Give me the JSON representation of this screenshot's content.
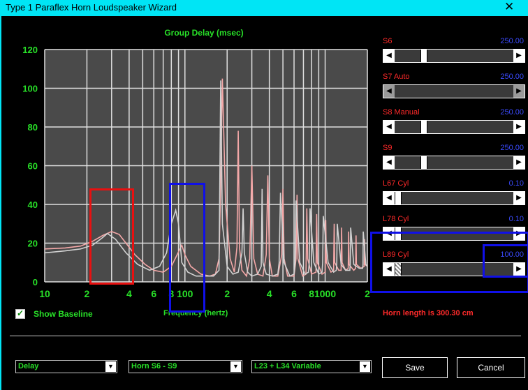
{
  "window": {
    "title": "Type 1 Paraflex Horn Loudspeaker Wizard",
    "close_glyph": "✕"
  },
  "chart_data": {
    "type": "line",
    "title": "Group Delay (msec)",
    "xlabel": "Frequency (hertz)",
    "ylabel": "",
    "x_scale": "log",
    "xlim": [
      10,
      2000
    ],
    "ylim": [
      0,
      120
    ],
    "x_ticks": [
      {
        "v": 10,
        "label": "10"
      },
      {
        "v": 20,
        "label": "2"
      },
      {
        "v": 40,
        "label": "4"
      },
      {
        "v": 60,
        "label": "6"
      },
      {
        "v": 80,
        "label": "8"
      },
      {
        "v": 100,
        "label": "100"
      },
      {
        "v": 200,
        "label": "2"
      },
      {
        "v": 400,
        "label": "4"
      },
      {
        "v": 600,
        "label": "6"
      },
      {
        "v": 800,
        "label": "8"
      },
      {
        "v": 1000,
        "label": "1000"
      },
      {
        "v": 2000,
        "label": "2"
      }
    ],
    "y_ticks": [
      0,
      20,
      40,
      60,
      80,
      100,
      120
    ],
    "grid": true,
    "legend": "none",
    "series": [
      {
        "color": "#f4a8a8",
        "x": [
          10,
          14,
          18,
          22,
          26,
          30,
          34,
          38,
          44,
          52,
          60,
          70,
          80,
          88,
          95,
          100,
          110,
          130,
          150,
          165,
          175,
          180,
          185,
          195,
          210,
          225,
          235,
          240,
          245,
          255,
          275,
          290,
          300,
          310,
          330,
          360,
          380,
          390,
          400,
          420,
          460,
          490,
          500,
          510,
          540,
          600,
          620,
          630,
          640,
          690,
          730,
          740,
          750,
          800,
          860,
          870,
          880,
          950,
          1000,
          1010,
          1020,
          1100,
          1150,
          1160,
          1170,
          1250,
          1300,
          1310,
          1320,
          1400,
          1460,
          1470,
          1480,
          1600,
          1650,
          1660,
          1670,
          1800,
          1900,
          1910,
          1920,
          2000
        ],
        "y": [
          17,
          17.5,
          18.5,
          21,
          24,
          26,
          24.5,
          20,
          14,
          9,
          6,
          5,
          8,
          14,
          19,
          14,
          8,
          4,
          3,
          4,
          12,
          50,
          105,
          40,
          12,
          5,
          18,
          78,
          18,
          6,
          3,
          12,
          60,
          12,
          4,
          3,
          14,
          55,
          12,
          3,
          3,
          14,
          48,
          12,
          3,
          3,
          12,
          45,
          12,
          3,
          4,
          38,
          12,
          4,
          5,
          35,
          10,
          4,
          5,
          32,
          10,
          5,
          6,
          30,
          10,
          6,
          6,
          28,
          10,
          6,
          7,
          26,
          9,
          6,
          7,
          24,
          9,
          7,
          8,
          22,
          9,
          8
        ]
      },
      {
        "color": "#d2d2d2",
        "x": [
          10,
          14,
          18,
          22,
          26,
          28,
          32,
          38,
          46,
          56,
          66,
          74,
          80,
          86,
          90,
          95,
          105,
          120,
          140,
          160,
          175,
          180,
          185,
          200,
          220,
          240,
          255,
          260,
          265,
          280,
          300,
          330,
          350,
          355,
          360,
          380,
          420,
          460,
          470,
          480,
          510,
          560,
          600,
          610,
          620,
          660,
          720,
          760,
          770,
          780,
          830,
          900,
          950,
          960,
          970,
          1050,
          1150,
          1200,
          1210,
          1220,
          1300,
          1400,
          1500,
          1510,
          1520,
          1600,
          1750,
          1850,
          1860,
          1870,
          1950,
          2000
        ],
        "y": [
          15,
          16,
          17,
          19,
          23,
          25,
          22,
          15,
          9,
          6,
          8,
          15,
          30,
          37,
          30,
          10,
          5,
          3,
          3,
          3,
          6,
          104,
          30,
          8,
          4,
          5,
          15,
          38,
          15,
          5,
          3,
          4,
          8,
          48,
          10,
          4,
          3,
          4,
          10,
          46,
          10,
          3,
          4,
          10,
          42,
          10,
          4,
          5,
          10,
          38,
          10,
          4,
          5,
          10,
          34,
          10,
          5,
          6,
          10,
          30,
          9,
          6,
          6,
          9,
          28,
          9,
          7,
          7,
          9,
          26,
          9,
          8
        ]
      }
    ]
  },
  "sliders": [
    {
      "label": "S6",
      "value": "250.00",
      "thumb": 0.23,
      "grey": false
    },
    {
      "label": "S7  Auto",
      "value": "250.00",
      "thumb": 0.23,
      "grey": true
    },
    {
      "label": "S8  Manual",
      "value": "250.00",
      "thumb": 0.23,
      "grey": false
    },
    {
      "label": "S9",
      "value": "250.00",
      "thumb": 0.23,
      "grey": false
    },
    {
      "label": "L67  Cyl",
      "value": "0.10",
      "thumb": 0.0,
      "grey": false
    },
    {
      "label": "L78  Cyl",
      "value": "0.10",
      "thumb": 0.0,
      "grey": false
    },
    {
      "label": "L89  Cyl",
      "value": "100.00",
      "thumb": 0.0,
      "grey": false
    }
  ],
  "show_baseline": {
    "label": "Show Baseline",
    "check": "✓"
  },
  "horn_length": "Horn length is 300.30 cm",
  "combos": [
    {
      "value": "Delay"
    },
    {
      "value": "Horn S6 - S9"
    },
    {
      "value": "L23 + L34 Variable"
    }
  ],
  "arrow_down": "▼",
  "arrow_left": "◀",
  "arrow_right": "▶",
  "buttons": {
    "save": "Save",
    "cancel": "Cancel"
  },
  "colors": {
    "title_bar": "#00e5f5",
    "plot_bg": "#4a4a4a",
    "axis_green": "#28e028",
    "label_red": "#ff2a2a",
    "value_blue": "#3b4bff",
    "annotation_blue": "#1010e8",
    "annotation_red": "#e81010"
  }
}
